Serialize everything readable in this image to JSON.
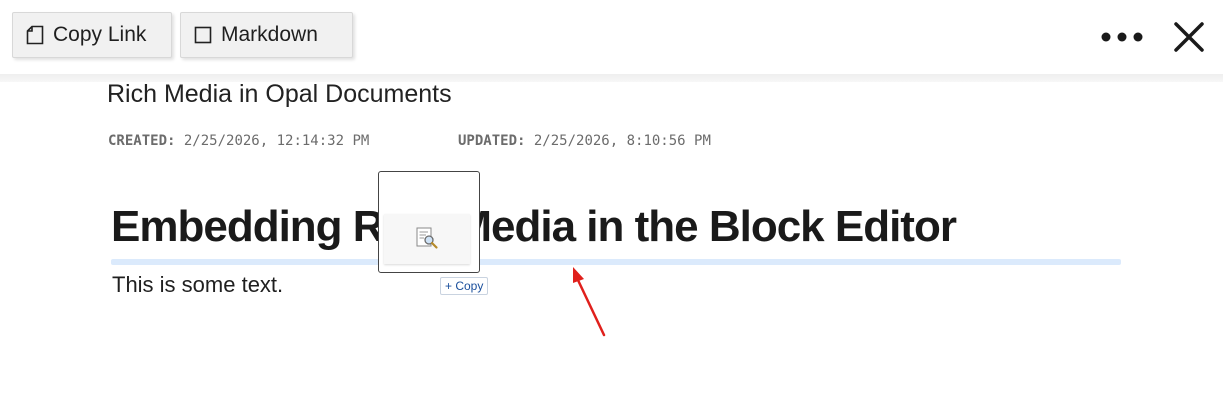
{
  "toolbar": {
    "copy_link_label": "Copy Link",
    "markdown_label": "Markdown",
    "copy_link_icon": "document-icon",
    "markdown_icon": "checkbox-icon",
    "more_icon": "more-horizontal-icon",
    "close_icon": "close-icon"
  },
  "document": {
    "title": "Rich Media in Opal Documents",
    "created_label": "CREATED:",
    "created_value": "2/25/2026, 12:14:32 PM",
    "updated_label": "UPDATED:",
    "updated_value": "2/25/2026, 8:10:56 PM",
    "heading": "Embedding Rich Media in the Block Editor",
    "body_text": "This is some text."
  },
  "drag": {
    "thumbnail_icon": "image-search-icon",
    "copy_badge": "+ Copy"
  },
  "colors": {
    "heading_underline": "#dbeafc",
    "annotation_arrow": "#e0201c",
    "copy_badge_text": "#1a4f9c"
  }
}
